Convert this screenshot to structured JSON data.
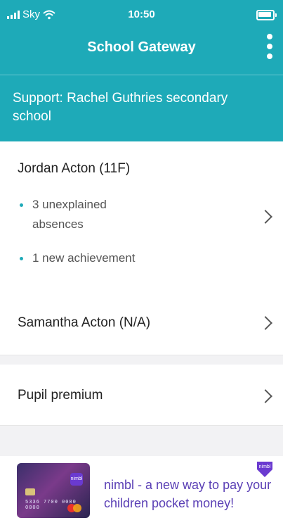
{
  "status": {
    "carrier": "Sky",
    "time": "10:50"
  },
  "header": {
    "title": "School Gateway"
  },
  "support": {
    "text": "Support: Rachel Guthries secondary school"
  },
  "students": [
    {
      "name": "Jordan Acton (11F)",
      "items": [
        "3 unexplained absences",
        "1 new achievement"
      ]
    },
    {
      "name": "Samantha Acton (N/A)"
    }
  ],
  "pupil_premium": {
    "label": "Pupil premium"
  },
  "ad": {
    "text": "nimbl - a new way to pay your children pocket money!",
    "brand": "nimbl",
    "card_number": "5336 7700 0000 0000"
  },
  "colors": {
    "primary": "#1eaab8",
    "ad_text": "#5a3fb5"
  },
  "icons": [
    "signal-icon",
    "wifi-icon",
    "battery-icon",
    "more-menu-icon",
    "chevron-right-icon"
  ]
}
